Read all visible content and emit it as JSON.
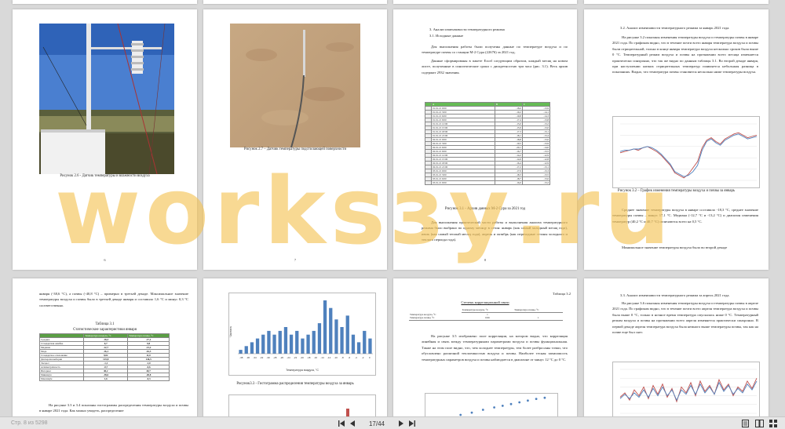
{
  "pages": {
    "p1": {
      "caption": "Рисунок 2.6 - Датчик температуры и влажности воздуха",
      "page_number": "6"
    },
    "p2": {
      "caption": "Рисунок 2.7 – Датчик температуры подстилающей поверхности",
      "page_number": "7"
    },
    "p3": {
      "heading1": "3.   Анализ изменчивости температурного режима",
      "heading2": "3.1.      Исходные данные",
      "para1": "Для выполнения работы были получены данные по температуре воздуха и по температуре почвы со станции М-2 Сура (22676) за 2021 год.",
      "para2": "Данные сформированы в пакете Excel следующим образом, каждый месяц на новом листе, полученные в синоптические сроки с дискретностью три часа (рис. 3.1). Весь архив содержит 2932 значения.",
      "caption": "Рисунок 3.1 - Архив данных М-2 Сура за 2021 год",
      "para3": "Для выполнения практической части работы и выполнения анализа температурного режима было выбрано по одному месяцу в сезон: январь (как самый холодный месяц года), июль (как самый теплый месяц года), апрель и октябрь (как переходные сезоны холодного и теплого периода года).",
      "page_number": "8",
      "table_header": [
        "A",
        "B",
        "C"
      ],
      "table_rows": [
        [
          "01.01.21 0:00",
          "-18,6",
          "-13,9"
        ],
        [
          "01.01.21 3:00",
          "-19,2",
          "-14,1"
        ],
        [
          "01.01.21 6:00",
          "-19,8",
          "-14,3"
        ],
        [
          "01.01.21 9:00",
          "-17,4",
          "-13,8"
        ],
        [
          "01.01.21 12:00",
          "-15,0",
          "-13,2"
        ],
        [
          "01.01.21 15:00",
          "-15,9",
          "-13,0"
        ],
        [
          "01.01.21 18:00",
          "-17,3",
          "-13,1"
        ],
        [
          "01.01.21 21:00",
          "-18,1",
          "-13,4"
        ],
        [
          "02.01.21 0:00",
          "-18,8",
          "-13,6"
        ],
        [
          "02.01.21 3:00",
          "-19,5",
          "-13,9"
        ],
        [
          "02.01.21 6:00",
          "-20,1",
          "-14,0"
        ],
        [
          "02.01.21 9:00",
          "-16,7",
          "-13,5"
        ],
        [
          "02.01.21 12:00",
          "-14,2",
          "-12,9"
        ],
        [
          "02.01.21 15:00",
          "-14,9",
          "-12,8"
        ],
        [
          "02.01.21 18:00",
          "-16,4",
          "-12,9"
        ],
        [
          "02.01.21 21:00",
          "-17,2",
          "-13,1"
        ],
        [
          "03.01.21 0:00",
          "-17,9",
          "-13,3"
        ],
        [
          "03.01.21 3:00",
          "-18,3",
          "-13,5"
        ],
        [
          "03.01.21 6:00",
          "-18,7",
          "-13,6"
        ],
        [
          "03.01.21 9:00",
          "-16,0",
          "-13,2"
        ]
      ]
    },
    "p4": {
      "heading": "3.2.   Анализ изменчивости температурного режима за январь 2021 года.",
      "para1": "На рисунке 3.2 показаны изменения температуры воздуха и температуры почвы в январе 2021 года. По графикам видно, что в течение почти всего января температура воздуха и почвы были отрицательной, только в конце января температура воздуха несколько сроков была выше 0 °С. Температурный режим воздуха и почвы на протяжении всего месяца изменяется практически синхронно, что так же видно по данным таблицы 3.1. Во второй декаде января, при наступлении низких отрицательных температур появляется небольшая разница в показаниях. Видно, что температура почвы становится несколько ниже температуры воздуха.",
      "caption": "Рисунок 3.2 – График изменения температуры воздуха и почвы за январь",
      "para2": "Среднее значение температуры воздуха в январе составило -18,3 °С, среднее значение температуры почвы – минус 17,1 °С. Медиана (-12,7 °С и -13,2 °С) и диапазон изменения температур (40,2 °С и 40,7 °С) отличаются всего на 0,5 °С.",
      "para3": "Минимальное значение температуры воздуха было во второй декаде",
      "page_number": "9"
    },
    "p5": {
      "para1": "января (-38,6    °С), а почвы (-40,8 °С)       – примерно в третьей декаде. Максимальное значение температуры воздуха и почвы было в третьей декаде января и составило 1,6 °С и минус 0,3 °С соответственно.",
      "table_title": "Таблица 3.1",
      "table_subtitle": "Статистические характеристики января",
      "stats_header": [
        "",
        "Температура воздуха, °С",
        "Температура почвы, °С"
      ],
      "stats_rows": [
        [
          "Среднее",
          "-18,3",
          "-17,1"
        ],
        [
          "Стандартная ошибка",
          "0,7",
          "0,8"
        ],
        [
          "Медиана",
          "-12,7",
          "-13,2"
        ],
        [
          "Мода",
          "-16,1",
          "-16,3"
        ],
        [
          "Стандартное отклонение",
          "9,02",
          "11,0"
        ],
        [
          "Дисперсия выборки",
          "125,8",
          "146,5"
        ],
        [
          "Эксцесс",
          "-1,1",
          "-1,0"
        ],
        [
          "Асимметричность",
          "-0,7",
          "-0,6"
        ],
        [
          "Интервал",
          "40,2",
          "40,7"
        ],
        [
          "Минимум",
          "-38,6",
          "-40,8"
        ],
        [
          "Максимум",
          "1,6",
          "-0,3"
        ]
      ],
      "para2": "На рисунке 3.3 и 3.4 показаны гистограммы распределения температуры воздуха и почвы в январе 2021 года. Как можно увидеть, распределение"
    },
    "p6": {
      "caption": "Рисунок3.3 - Гистограмма распределения температуры воздуха за январь",
      "xlabel": "Температура воздуха, °С",
      "ylabel": "Частота",
      "tick_labels": [
        "-38",
        "-36",
        "-34",
        "-32",
        "-30",
        "-28",
        "-26",
        "-24",
        "-22",
        "-20",
        "-18",
        "-16",
        "-14",
        "-12",
        "-10",
        "-8",
        "-6",
        "-4",
        "-2",
        "0"
      ]
    },
    "p7": {
      "table_label": "Таблица 3.2",
      "table_title": "Степень корреляционной связи",
      "corr_header": [
        "",
        "Температура воздуха, °С",
        "Температура почвы, °С"
      ],
      "corr_row1": [
        "Температура воздуха, °С",
        "1",
        ""
      ],
      "corr_row2": [
        "Температура почвы, °С",
        "0,96",
        "1"
      ],
      "para1": "На рисунке 3.5 изображено поле корреляции, на котором видно, что корреляция линейная и связь между температурными параметрами воздуха и почвы функциональная. Также на этом поле видно, что, чем холоднее температуры, тем более разбросаны точки, что обусловлено различной теплоемкостью воздуха и почвы. Наиболее тесная зависимость температурных параметров воздуха и почвы наблюдается в диапазоне от минус 12 °С до 0 °С."
    },
    "p8": {
      "heading": "3.3.   Анализ изменчивости температурного режима за апрель 2021 года.",
      "para1": "На рисунке 3.6 показаны изменения температуры воздуха и температуры почвы в апреле 2021 года. По графикам видно, что в течение почти всего апреля температура воздуха и почвы была выше 0 °С, только в ночное время температура опускалась ниже 0 °С. Температурный режим воздуха и почвы на протяжении всего апреля изменяется практически синхронно. В первой декаде апреля температура воздуха была немного выше температуры почвы, так как на почве еще был снег."
    }
  },
  "chart_jan": {
    "type": "line",
    "series": [
      {
        "values": [
          -18,
          -17,
          -16,
          -15,
          -16,
          -14,
          -13,
          -15,
          -17,
          -20,
          -24,
          -28,
          -34,
          -36,
          -38,
          -35,
          -30,
          -25,
          -14,
          -8,
          -6,
          -9,
          -11,
          -7,
          -5,
          -3,
          -2,
          -4,
          -6,
          -5,
          -4
        ]
      },
      {
        "values": [
          -17,
          -16,
          -16,
          -15,
          -15,
          -14,
          -13,
          -14,
          -16,
          -19,
          -23,
          -27,
          -33,
          -35,
          -37,
          -36,
          -33,
          -28,
          -16,
          -9,
          -7,
          -10,
          -12,
          -8,
          -6,
          -4,
          -3,
          -5,
          -7,
          -6,
          -5
        ]
      }
    ],
    "colors": [
      "#c0504d",
      "#4f81bd"
    ],
    "ylim": [
      -40,
      5
    ]
  },
  "chart_hist": {
    "type": "bar",
    "values": [
      1,
      2,
      3,
      4,
      5,
      6,
      5,
      6,
      7,
      5,
      6,
      4,
      5,
      6,
      8,
      14,
      12,
      9,
      7,
      10,
      5,
      3,
      6,
      4
    ],
    "color": "#4f81bd"
  },
  "chart_apr": {
    "type": "line",
    "series": [
      {
        "values": [
          1,
          4,
          -1,
          6,
          2,
          8,
          0,
          9,
          3,
          10,
          1,
          7,
          -2,
          8,
          4,
          11,
          2,
          12,
          5,
          9,
          3,
          13,
          6,
          10,
          2,
          8,
          5,
          12,
          7,
          14
        ]
      },
      {
        "values": [
          0,
          3,
          0,
          4,
          1,
          6,
          1,
          7,
          2,
          8,
          2,
          6,
          -1,
          6,
          3,
          9,
          3,
          10,
          4,
          8,
          3,
          11,
          5,
          9,
          3,
          7,
          4,
          10,
          6,
          12
        ]
      }
    ],
    "colors": [
      "#c0504d",
      "#4f81bd"
    ],
    "ylim": [
      -10,
      20
    ]
  },
  "chart_corr": {
    "type": "scatter",
    "series": [
      {
        "values": [
          [
            -38,
            -40
          ],
          [
            -34,
            -36
          ],
          [
            -30,
            -31
          ],
          [
            -26,
            -27
          ],
          [
            -22,
            -22
          ],
          [
            -18,
            -18
          ],
          [
            -15,
            -15
          ],
          [
            -12,
            -12
          ],
          [
            -9,
            -9
          ],
          [
            -6,
            -6
          ],
          [
            -3,
            -3
          ],
          [
            0,
            -1
          ]
        ]
      }
    ]
  },
  "watermark": "worksзу.ru",
  "toolbar": {
    "left_text": "Стр. 8 из 5298",
    "page_indicator": "17/44",
    "first_icon": "first-page-icon",
    "prev_icon": "previous-page-icon",
    "next_icon": "next-page-icon",
    "last_icon": "last-page-icon"
  }
}
